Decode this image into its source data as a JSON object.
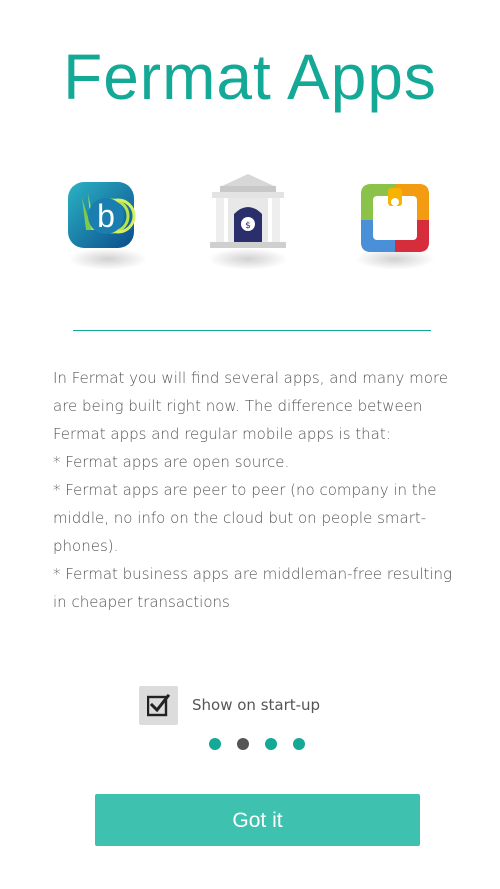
{
  "title": "Fermat Apps",
  "apps": [
    {
      "icon": "bitcoin-wallet-icon"
    },
    {
      "icon": "bank-icon"
    },
    {
      "icon": "shopping-bag-icon"
    }
  ],
  "description": [
    "In Fermat you will find several apps, and many more are being built right now. The difference between Fermat apps and regular mobile apps is that:",
    "* Fermat apps are open source.",
    "* Fermat apps are peer to peer (no company in the middle, no info on the cloud but on people smart-phones).",
    "* Fermat business apps are middleman-free resulting in cheaper transactions"
  ],
  "startup": {
    "label": "Show on start-up",
    "checked": true
  },
  "pager": {
    "count": 4,
    "active_index": 1
  },
  "colors": {
    "accent": "#14a896",
    "button": "#3fc1b0",
    "dot_inactive": "#14a896",
    "dot_active": "#555555"
  },
  "button": {
    "label": "Got it"
  }
}
